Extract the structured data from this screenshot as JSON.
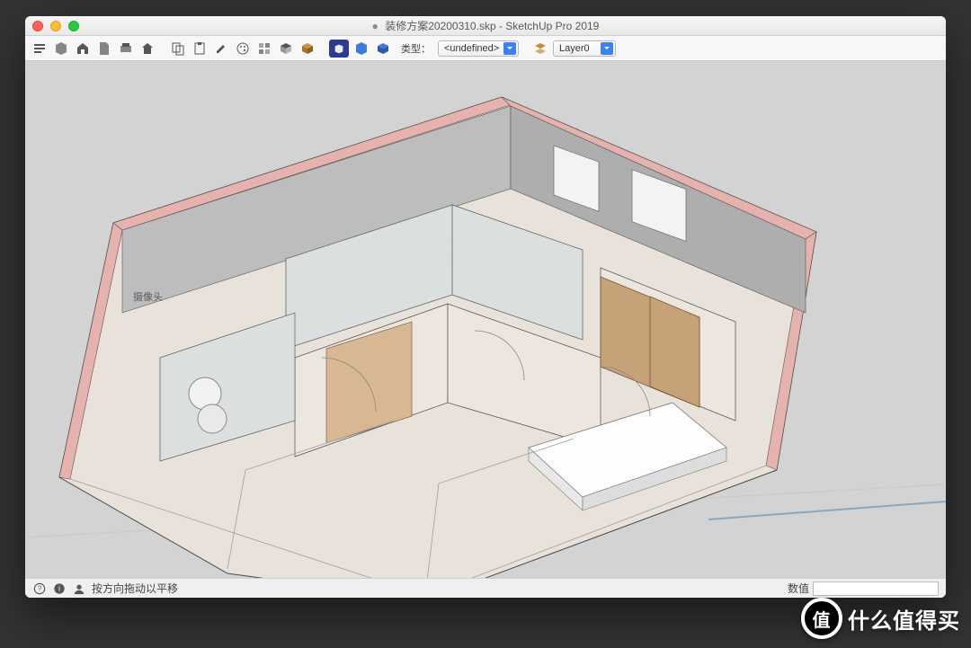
{
  "window": {
    "title_prefix": "●",
    "title": "装修方案20200310.skp - SketchUp Pro 2019"
  },
  "toolbar": {
    "icons": [
      "model-info-icon",
      "components-icon",
      "house-icon",
      "file-icon",
      "print-icon",
      "home-icon",
      "copy-icon",
      "paste-icon",
      "paint-icon",
      "palette-icon",
      "materials-icon",
      "block-icon",
      "cube-icon",
      "3dwarehouse-icon",
      "extension-icon",
      "box-icon"
    ],
    "type_label": "类型：",
    "type_value": "<undefined>",
    "layer_icon": "layers-icon",
    "layer_value": "Layer0"
  },
  "viewport": {
    "label_in_scene": "摄像头"
  },
  "statusbar": {
    "hint": "按方向拖动以平移",
    "value_label": "数值",
    "value": ""
  },
  "watermark": {
    "badge": "值",
    "text": "什么值得买"
  }
}
